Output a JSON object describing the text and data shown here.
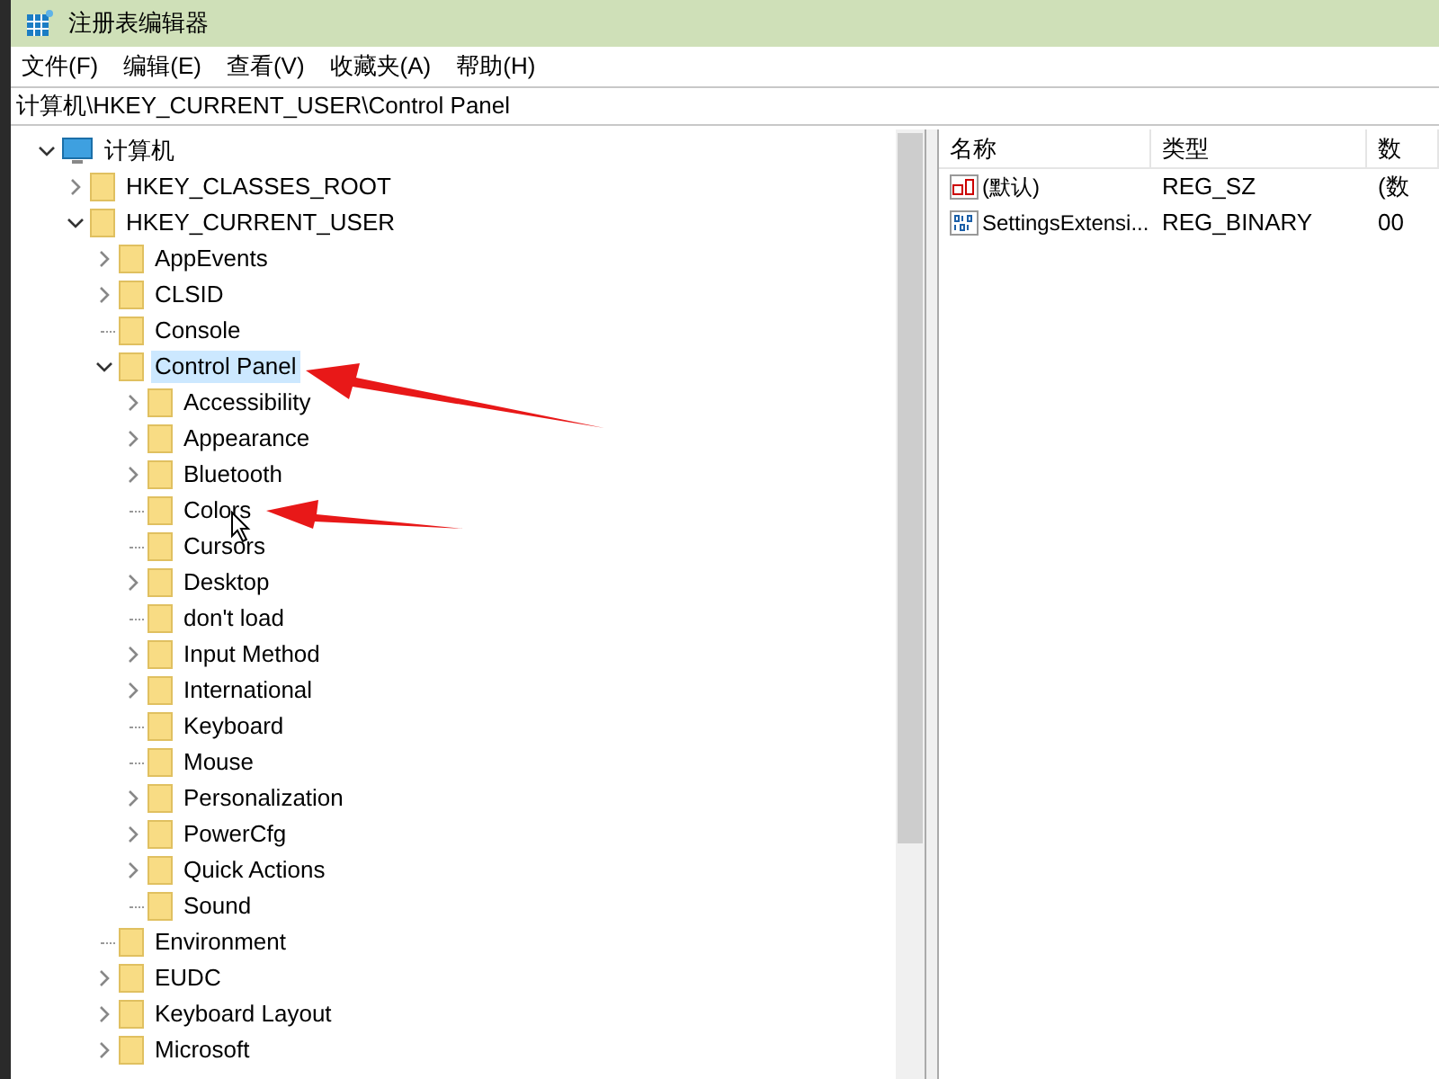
{
  "window": {
    "title": "注册表编辑器"
  },
  "menu": [
    "文件(F)",
    "编辑(E)",
    "查看(V)",
    "收藏夹(A)",
    "帮助(H)"
  ],
  "address": "计算机\\HKEY_CURRENT_USER\\Control Panel",
  "tree": [
    {
      "label": "计算机",
      "kind": "computer",
      "expanded": true,
      "selected": false,
      "children": [
        {
          "label": "HKEY_CLASSES_ROOT",
          "kind": "node",
          "expanded": false,
          "selected": false
        },
        {
          "label": "HKEY_CURRENT_USER",
          "kind": "node",
          "expanded": true,
          "selected": false,
          "children": [
            {
              "label": "AppEvents",
              "kind": "node",
              "expanded": false,
              "selected": false
            },
            {
              "label": "CLSID",
              "kind": "node",
              "expanded": false,
              "selected": false
            },
            {
              "label": "Console",
              "kind": "leaf",
              "selected": false
            },
            {
              "label": "Control Panel",
              "kind": "node",
              "expanded": true,
              "selected": true,
              "children": [
                {
                  "label": "Accessibility",
                  "kind": "node",
                  "expanded": false,
                  "selected": false
                },
                {
                  "label": "Appearance",
                  "kind": "node",
                  "expanded": false,
                  "selected": false
                },
                {
                  "label": "Bluetooth",
                  "kind": "node",
                  "expanded": false,
                  "selected": false
                },
                {
                  "label": "Colors",
                  "kind": "leaf",
                  "selected": false
                },
                {
                  "label": "Cursors",
                  "kind": "leaf",
                  "selected": false
                },
                {
                  "label": "Desktop",
                  "kind": "node",
                  "expanded": false,
                  "selected": false
                },
                {
                  "label": "don't load",
                  "kind": "leaf",
                  "selected": false
                },
                {
                  "label": "Input Method",
                  "kind": "node",
                  "expanded": false,
                  "selected": false
                },
                {
                  "label": "International",
                  "kind": "node",
                  "expanded": false,
                  "selected": false
                },
                {
                  "label": "Keyboard",
                  "kind": "leaf",
                  "selected": false
                },
                {
                  "label": "Mouse",
                  "kind": "leaf",
                  "selected": false
                },
                {
                  "label": "Personalization",
                  "kind": "node",
                  "expanded": false,
                  "selected": false
                },
                {
                  "label": "PowerCfg",
                  "kind": "node",
                  "expanded": false,
                  "selected": false
                },
                {
                  "label": "Quick Actions",
                  "kind": "node",
                  "expanded": false,
                  "selected": false
                },
                {
                  "label": "Sound",
                  "kind": "leaf",
                  "selected": false
                }
              ]
            },
            {
              "label": "Environment",
              "kind": "leaf",
              "selected": false
            },
            {
              "label": "EUDC",
              "kind": "node",
              "expanded": false,
              "selected": false
            },
            {
              "label": "Keyboard Layout",
              "kind": "node",
              "expanded": false,
              "selected": false
            },
            {
              "label": "Microsoft",
              "kind": "node",
              "expanded": false,
              "selected": false
            }
          ]
        }
      ]
    }
  ],
  "values": {
    "columns": [
      "名称",
      "类型",
      "数"
    ],
    "rows": [
      {
        "kind": "string",
        "name": "(默认)",
        "type": "REG_SZ",
        "column_3": "(数"
      },
      {
        "kind": "binary",
        "name": "SettingsExtensi...",
        "type": "REG_BINARY",
        "column_3": "00"
      }
    ]
  }
}
